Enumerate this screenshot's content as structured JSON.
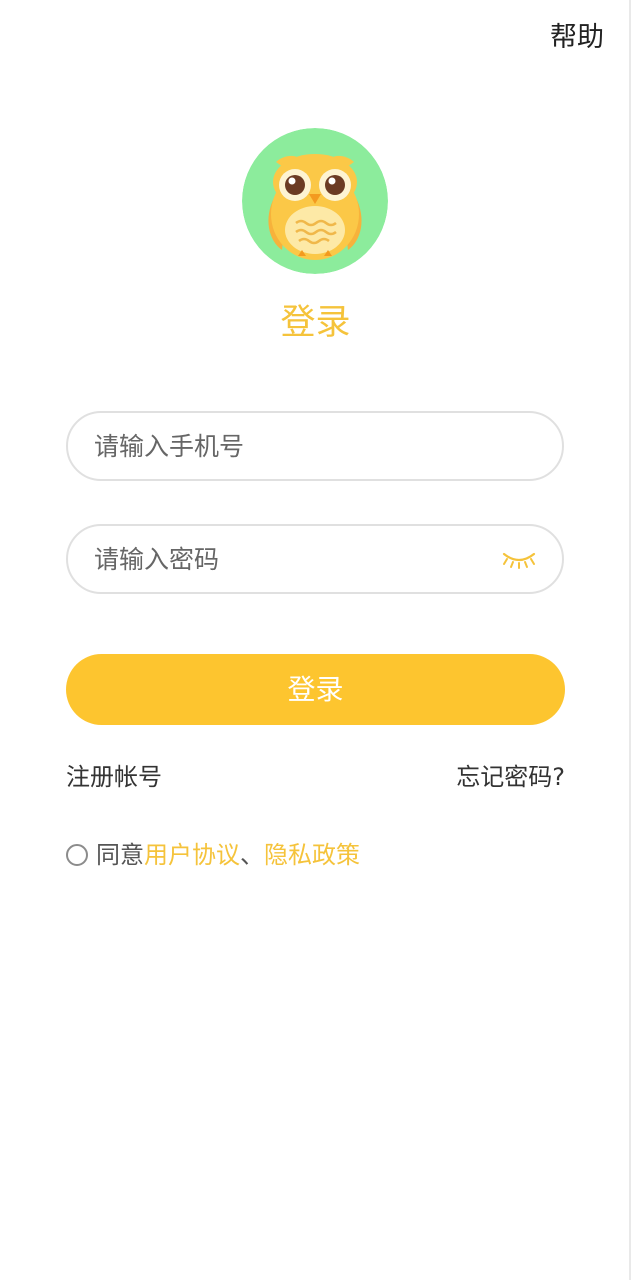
{
  "header": {
    "help_label": "帮助"
  },
  "logo": {
    "icon": "owl-icon"
  },
  "page_title": "登录",
  "form": {
    "phone_placeholder": "请输入手机号",
    "password_placeholder": "请输入密码",
    "password_toggle_icon": "eye-closed-icon",
    "login_label": "登录"
  },
  "links": {
    "register_label": "注册帐号",
    "forgot_label": "忘记密码?"
  },
  "agreement": {
    "prefix": "同意",
    "user_agreement": "用户协议",
    "separator": "、",
    "privacy_policy": "隐私政策",
    "checked": false
  },
  "colors": {
    "accent": "#f5c33b",
    "button": "#fdc52f",
    "logo_background": "#8cec9c",
    "field_border": "#e0e0e0"
  }
}
